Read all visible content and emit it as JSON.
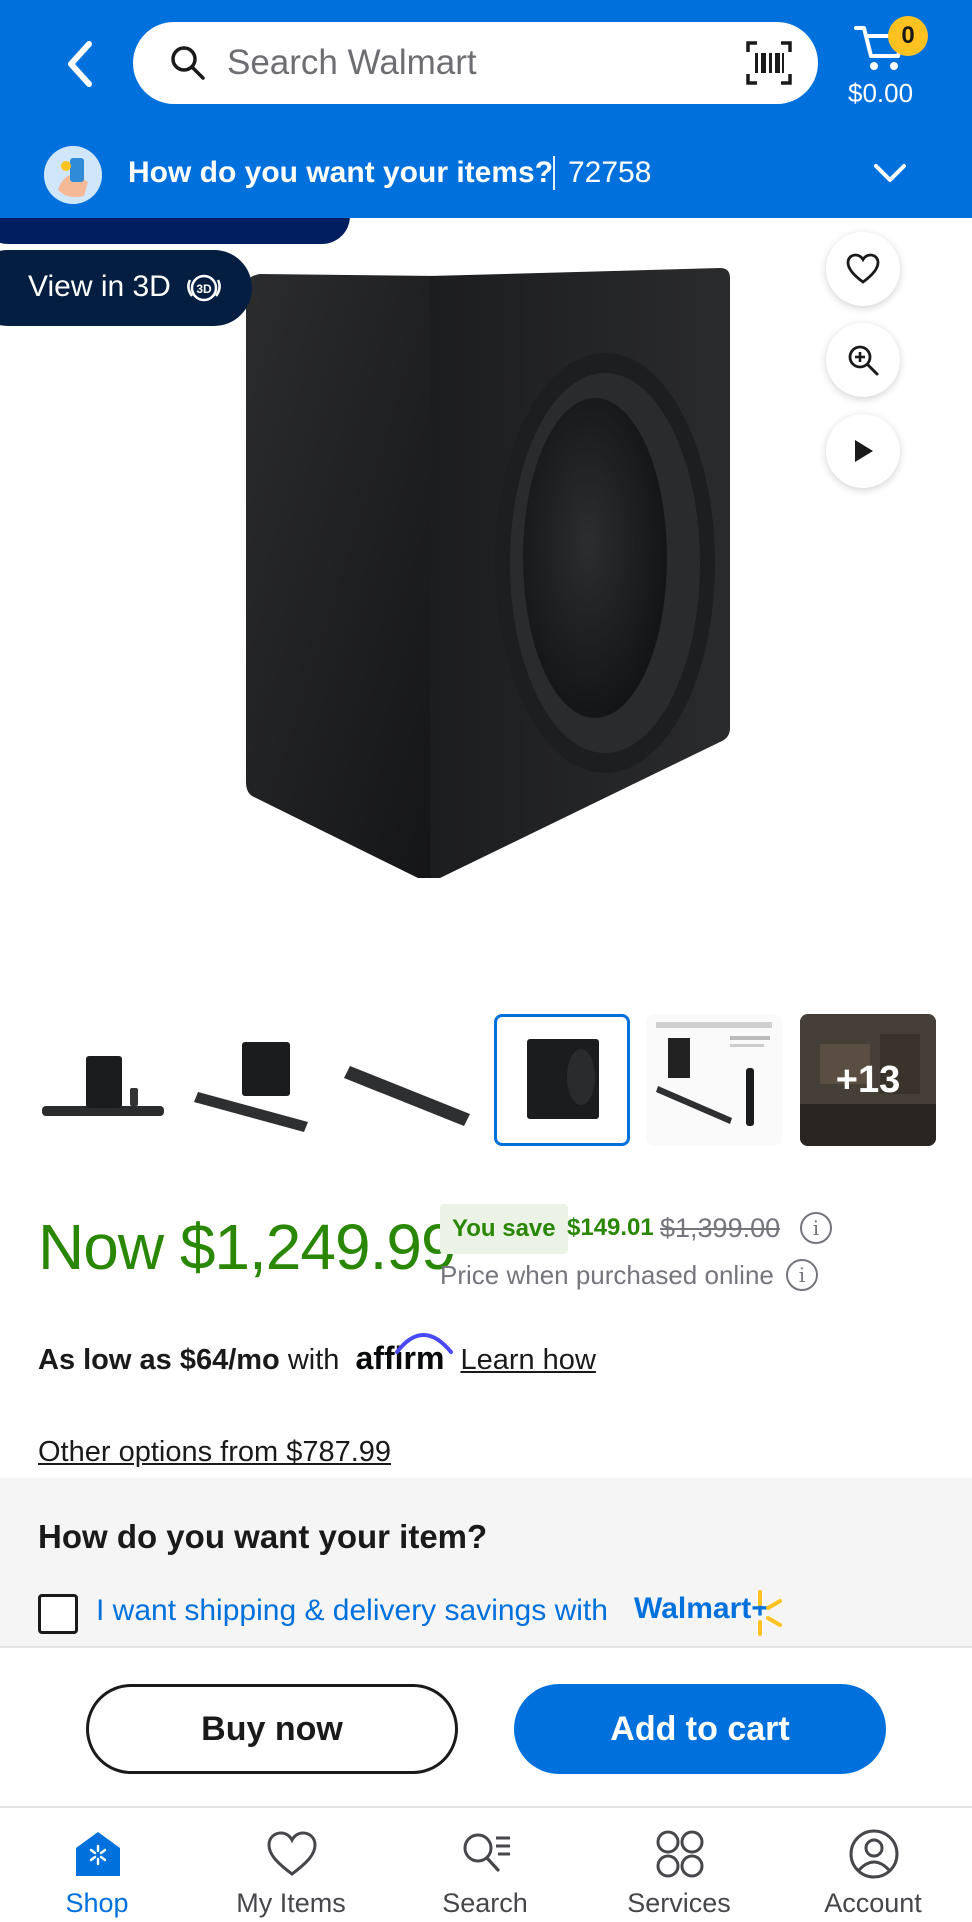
{
  "header": {
    "search_placeholder": "Search Walmart",
    "cart_count": "0",
    "cart_total": "$0.00"
  },
  "delivery": {
    "question": "How do you want your items?",
    "zip": "72758"
  },
  "hero": {
    "view_3d_label": "View in 3D"
  },
  "thumbnails": {
    "more_count": "+13"
  },
  "price": {
    "now": "Now $1,249.99",
    "you_save_label": "You save",
    "save_amount": "$149.01",
    "was": "$1,399.00",
    "note": "Price when purchased online"
  },
  "financing": {
    "prefix": "As low as ",
    "monthly": "$64/mo",
    "with": " with",
    "provider": "affirm",
    "learn_how": "Learn how"
  },
  "other_options": "Other options from $787.99",
  "fulfillment": {
    "title": "How do you want your item?",
    "plus_text": "I want shipping & delivery savings with",
    "plus_brand": "Walmart+"
  },
  "actions": {
    "buy_now": "Buy now",
    "add_to_cart": "Add to cart"
  },
  "nav": [
    {
      "label": "Shop"
    },
    {
      "label": "My Items"
    },
    {
      "label": "Search"
    },
    {
      "label": "Services"
    },
    {
      "label": "Account"
    }
  ],
  "colors": {
    "brand_blue": "#0071dc",
    "price_green": "#2a8703",
    "spark_yellow": "#ffc220"
  }
}
